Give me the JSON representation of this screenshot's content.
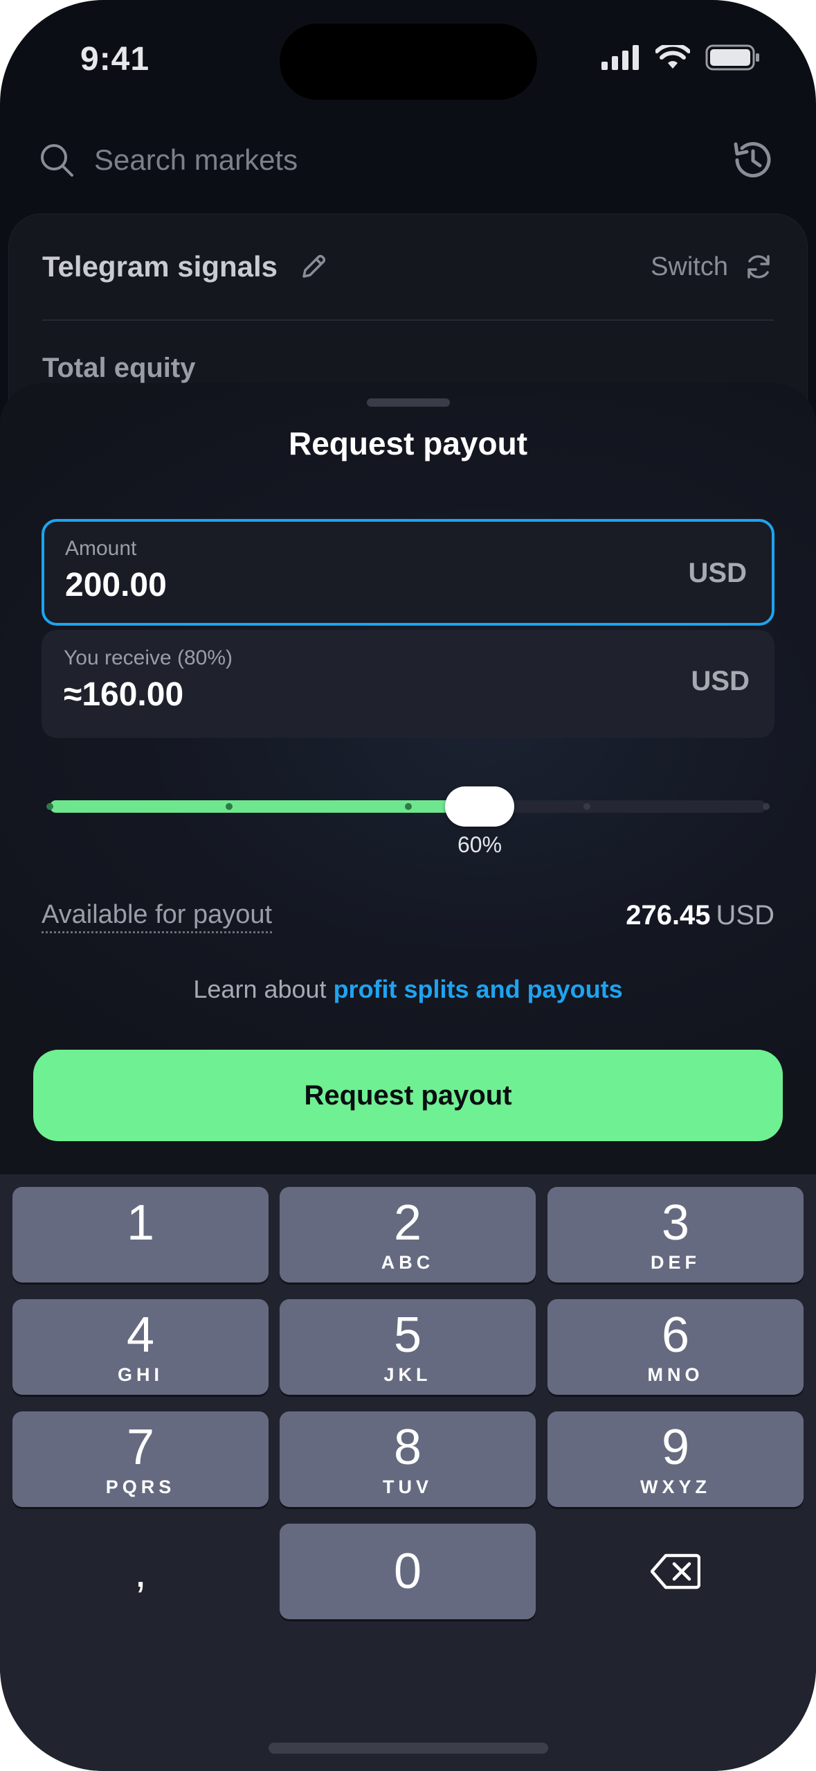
{
  "status_bar": {
    "time": "9:41"
  },
  "background": {
    "search_placeholder": "Search markets",
    "account_name": "Telegram signals",
    "switch_label": "Switch",
    "equity_label": "Total equity"
  },
  "sheet": {
    "title": "Request payout",
    "amount": {
      "label": "Amount",
      "value": "200.00",
      "currency": "USD"
    },
    "receive": {
      "label": "You receive (80%)",
      "value": "≈160.00",
      "currency": "USD"
    },
    "slider": {
      "value_percent": 60,
      "label": "60%",
      "steps": [
        0,
        25,
        50,
        75,
        100
      ]
    },
    "available": {
      "label": "Available for payout",
      "value": "276.45",
      "currency": "USD"
    },
    "learn": {
      "prefix": "Learn about",
      "link": "profit splits and payouts"
    },
    "submit_label": "Request payout"
  },
  "keyboard": {
    "keys": [
      {
        "digit": "1",
        "letters": ""
      },
      {
        "digit": "2",
        "letters": "ABC"
      },
      {
        "digit": "3",
        "letters": "DEF"
      },
      {
        "digit": "4",
        "letters": "GHI"
      },
      {
        "digit": "5",
        "letters": "JKL"
      },
      {
        "digit": "6",
        "letters": "MNO"
      },
      {
        "digit": "7",
        "letters": "PQRS"
      },
      {
        "digit": "8",
        "letters": "TUV"
      },
      {
        "digit": "9",
        "letters": "WXYZ"
      },
      {
        "digit": "0",
        "letters": ""
      }
    ],
    "decimal_key": ",",
    "delete_icon": "backspace-icon"
  },
  "colors": {
    "accent_green": "#6ff092",
    "accent_blue": "#1ea4f0"
  }
}
